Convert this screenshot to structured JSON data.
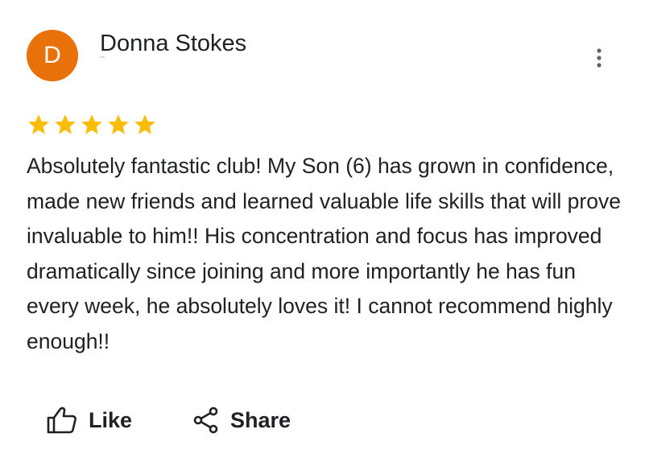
{
  "reviewer": {
    "initial": "D",
    "name": "Donna Stokes",
    "avatar_color": "#e8710a"
  },
  "rating": {
    "stars": 5,
    "max": 5,
    "star_color": "#fbbc04"
  },
  "review": {
    "text": "Absolutely fantastic club! My Son (6) has grown in confidence, made new friends and learned valuable life skills that will prove invaluable to him!! His concentration and focus has improved dramatically since joining and more importantly he has fun every week, he absolutely loves it! I cannot recommend highly enough!!"
  },
  "menu": {
    "icon": "more-vertical-icon"
  },
  "actions": {
    "like_label": "Like",
    "like_icon": "thumbs-up-icon",
    "share_label": "Share",
    "share_icon": "share-icon"
  }
}
